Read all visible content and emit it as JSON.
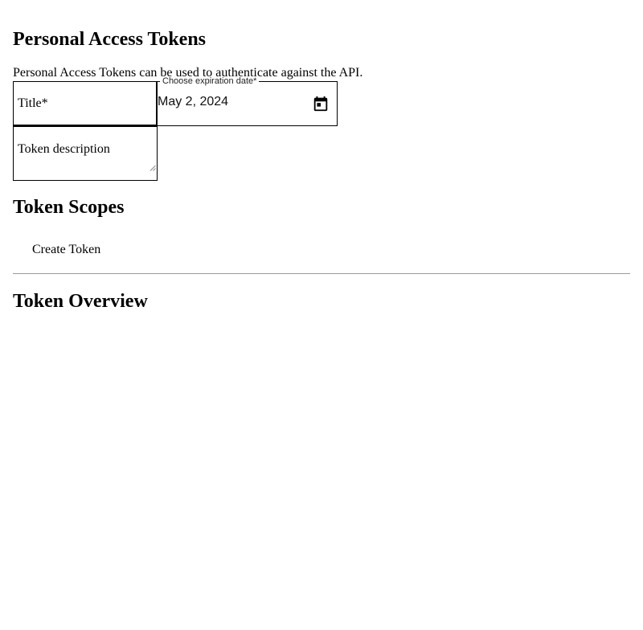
{
  "page": {
    "title": "Personal Access Tokens",
    "intro": "Personal Access Tokens can be used to authenticate against the API."
  },
  "form": {
    "title_placeholder": "Title*",
    "title_value": "",
    "expiration_label": "Choose expiration date*",
    "expiration_value": "May 2, 2024",
    "expiration_icon": "calendar-icon",
    "description_placeholder": "Token description",
    "description_value": ""
  },
  "scopes": {
    "heading": "Token Scopes",
    "create_label": "Create Token"
  },
  "overview": {
    "heading": "Token Overview"
  }
}
